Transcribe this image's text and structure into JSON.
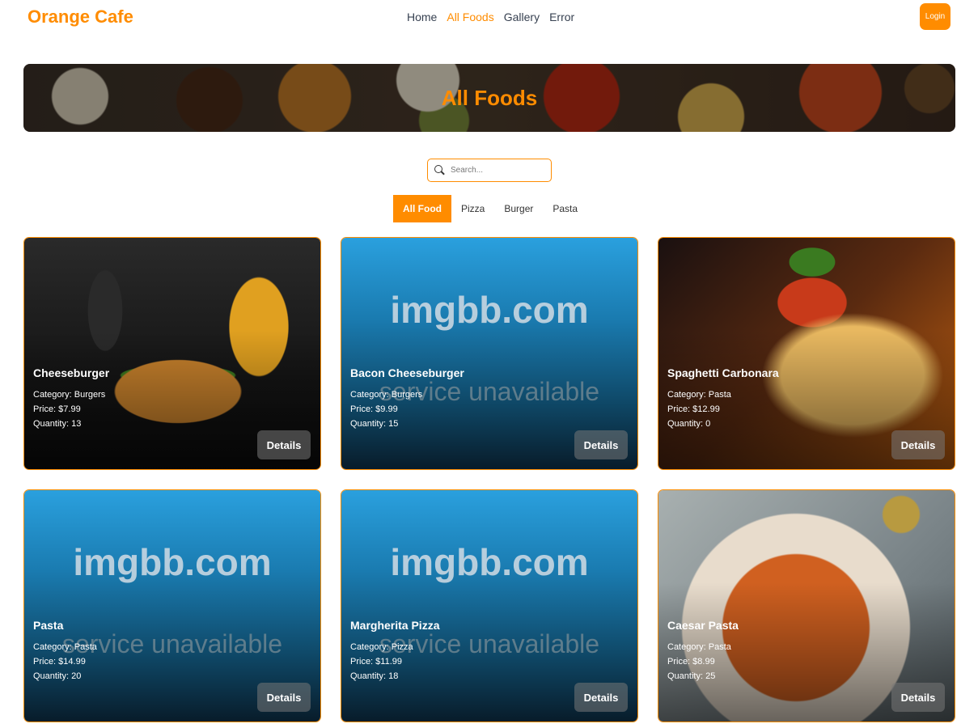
{
  "nav": {
    "brand": "Orange Cafe",
    "links": [
      "Home",
      "All Foods",
      "Gallery",
      "Error"
    ],
    "active_link": "All Foods",
    "login_label": "Login"
  },
  "banner": {
    "title": "All Foods"
  },
  "search": {
    "placeholder": "Search..."
  },
  "filters": {
    "tabs": [
      "All Food",
      "Pizza",
      "Burger",
      "Pasta"
    ],
    "active": "All Food"
  },
  "placeholder_image": {
    "line1": "imgbb.com",
    "line2": "service unavailable"
  },
  "foods": [
    {
      "name": "Cheeseburger",
      "category": "Category: Burgers",
      "price": "Price: $7.99",
      "quantity": "Quantity: 13",
      "details": "Details"
    },
    {
      "name": "Bacon Cheeseburger",
      "category": "Category: Burgers",
      "price": "Price: $9.99",
      "quantity": "Quantity: 15",
      "details": "Details"
    },
    {
      "name": "Spaghetti Carbonara",
      "category": "Category: Pasta",
      "price": "Price: $12.99",
      "quantity": "Quantity: 0",
      "details": "Details"
    },
    {
      "name": "Pasta",
      "category": "Category: Pasta",
      "price": "Price: $14.99",
      "quantity": "Quantity: 20",
      "details": "Details"
    },
    {
      "name": "Margherita Pizza",
      "category": "Category: Pizza",
      "price": "Price: $11.99",
      "quantity": "Quantity: 18",
      "details": "Details"
    },
    {
      "name": "Caesar Pasta",
      "category": "Category: Pasta",
      "price": "Price: $8.99",
      "quantity": "Quantity: 25",
      "details": "Details"
    }
  ],
  "colors": {
    "accent": "#ff8c00"
  }
}
